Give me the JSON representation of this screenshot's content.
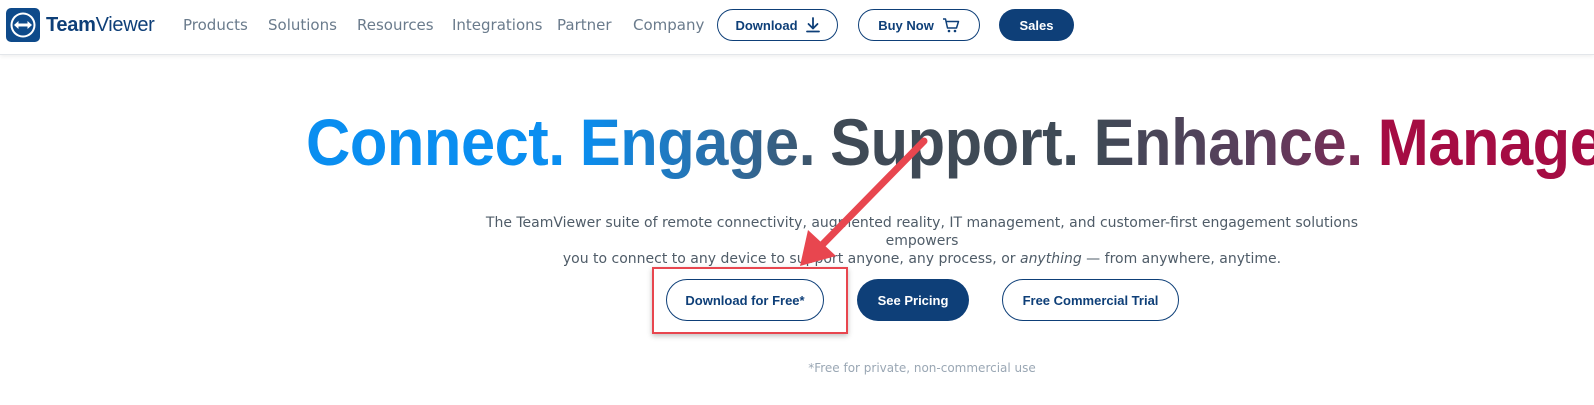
{
  "header": {
    "logo": {
      "brand_bold": "Team",
      "brand_light": "Viewer"
    },
    "nav": [
      "Products",
      "Solutions",
      "Resources",
      "Integrations",
      "Partner",
      "Company"
    ],
    "buttons": {
      "download": "Download",
      "buy_now": "Buy Now",
      "sales": "Sales"
    }
  },
  "hero": {
    "headline": [
      "Connect.",
      "Engage.",
      "Support.",
      "Enhance.",
      "Manage."
    ],
    "description": {
      "line1": "The TeamViewer suite of remote connectivity, augmented reality, IT management, and customer-first engagement solutions empowers",
      "line2_before": "you to connect to any device to support anyone, any process, or ",
      "line2_em": "anything",
      "line2_after": " — from anywhere, anytime."
    },
    "cta": {
      "download_free": "Download for Free*",
      "see_pricing": "See Pricing",
      "free_trial": "Free Commercial Trial"
    },
    "footnote": "*Free for private, non-commercial use"
  },
  "annotation": {
    "color": "#e8464f",
    "target": "download_free"
  },
  "colors": {
    "brand_navy": "#0e3f78",
    "connect_blue": "#0a8ef0",
    "support_slate": "#3f4a56",
    "manage_crimson": "#a50c43"
  }
}
